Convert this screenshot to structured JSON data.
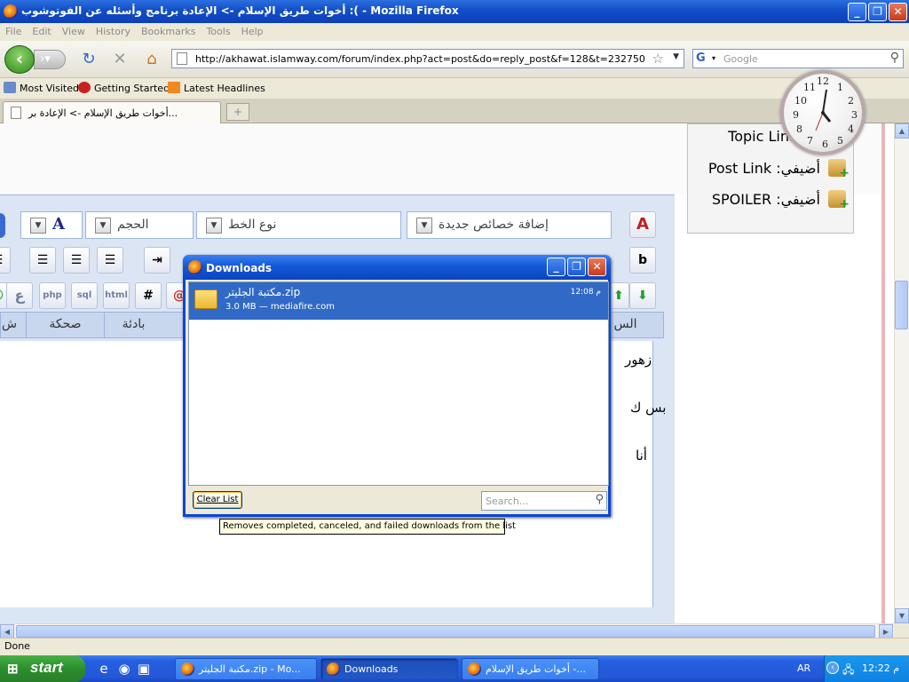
{
  "window": {
    "title": "أخوات طريق الإسلام -> الإعادة برنامج وأسئله عن الفوتوشوب :( - Mozilla Firefox"
  },
  "menu": [
    "File",
    "Edit",
    "View",
    "History",
    "Bookmarks",
    "Tools",
    "Help"
  ],
  "nav": {
    "url": "http://akhawat.islamway.com/forum/index.php?act=post&do=reply_post&f=128&t=232750",
    "search_placeholder": "Google"
  },
  "bookmarks": [
    "Most Visited",
    "Getting Started",
    "Latest Headlines"
  ],
  "tab": {
    "title": "أخوات طريق الإسلام -> الإعادة بر..."
  },
  "side_links": [
    {
      "label": "أضيفي: Topic Link"
    },
    {
      "label": "أضيفي: Post Link"
    },
    {
      "label": "أضيفي: SPOILER"
    }
  ],
  "editor": {
    "font_type": "نوع الخط",
    "font_size": "الحجم",
    "add_new": "إضافة خصائص جديدة",
    "tabs": [
      "صحكة",
      "بادئة",
      "الس"
    ],
    "lines": [
      "زهور",
      "بس ك",
      "أنا"
    ],
    "btn_b": "b",
    "btn_a": "A",
    "btn_u": "ع",
    "btn_php": "php",
    "btn_sql": "sql",
    "btn_html": "html",
    "btn_hash": "#"
  },
  "clock": {
    "numbers": [
      "12",
      "1",
      "2",
      "3",
      "4",
      "5",
      "6",
      "7",
      "8",
      "9",
      "10",
      "11"
    ]
  },
  "downloads": {
    "title": "Downloads",
    "item": {
      "name": "مكتبة الجليتر.zip",
      "info": "3.0 MB — mediafire.com",
      "time": "12:08 م"
    },
    "clear_label": "Clear List",
    "search_placeholder": "Search...",
    "tooltip": "Removes completed, canceled, and failed downloads from the list"
  },
  "status": "Done",
  "taskbar": {
    "start": "start",
    "tasks": [
      "مكتبة الجليتر.zip - Mo...",
      "Downloads",
      "أخوات طريق الإسلام -..."
    ],
    "lang": "AR",
    "time": "12:22 م"
  }
}
